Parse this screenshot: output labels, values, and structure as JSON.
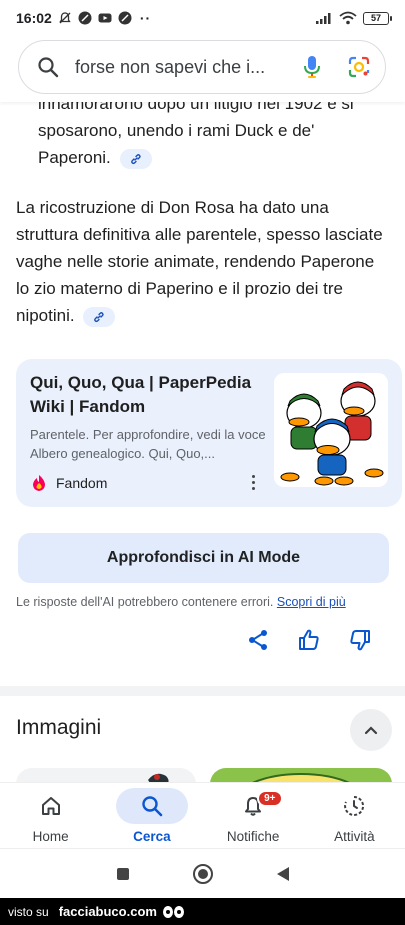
{
  "status_bar": {
    "time": "16:02",
    "dots": "··",
    "battery": "57"
  },
  "search": {
    "query": "forse non sapevi che i...",
    "icons": [
      "search-icon",
      "mic-icon",
      "google-lens-icon"
    ]
  },
  "content": {
    "para_top": "innamorarono dopo un litigio nel 1902 e si sposarono, unendo i rami Duck e de' Paperoni.",
    "para_main": "La ricostruzione di Don Rosa ha dato una struttura definitiva alle parentele, spesso lasciate vaghe nelle storie animate, rendendo Paperone lo zio materno di Paperino e il prozio dei tre nipotini."
  },
  "source_card": {
    "title": "Qui, Quo, Qua | PaperPedia Wiki | Fandom",
    "snippet": "Parentele. Per approfondire, vedi la voce Albero genealogico. Qui, Quo,...",
    "source_name": "Fandom",
    "thumb_icon": "duck-nephews-image"
  },
  "ai_mode_button": "Approfondisci in AI Mode",
  "disclaimer": {
    "text": "Le risposte dell'AI potrebbero contenere errori.",
    "link": "Scopri di più"
  },
  "feedback_icons": [
    "share-icon",
    "thumbs-up-icon",
    "thumbs-down-icon"
  ],
  "images_section": {
    "title": "Immagini"
  },
  "bottom_nav": {
    "items": [
      {
        "label": "Home",
        "icon": "home-icon"
      },
      {
        "label": "Cerca",
        "icon": "search-icon",
        "active": true
      },
      {
        "label": "Notifiche",
        "icon": "bell-icon",
        "badge": "9+"
      },
      {
        "label": "Attività",
        "icon": "activity-icon"
      }
    ]
  },
  "watermark": {
    "prefix": "visto su",
    "brand": "facciabuco.com"
  },
  "colors": {
    "accent": "#0b57d0",
    "card_bg": "#eaf1fc",
    "badge": "#d93025"
  }
}
